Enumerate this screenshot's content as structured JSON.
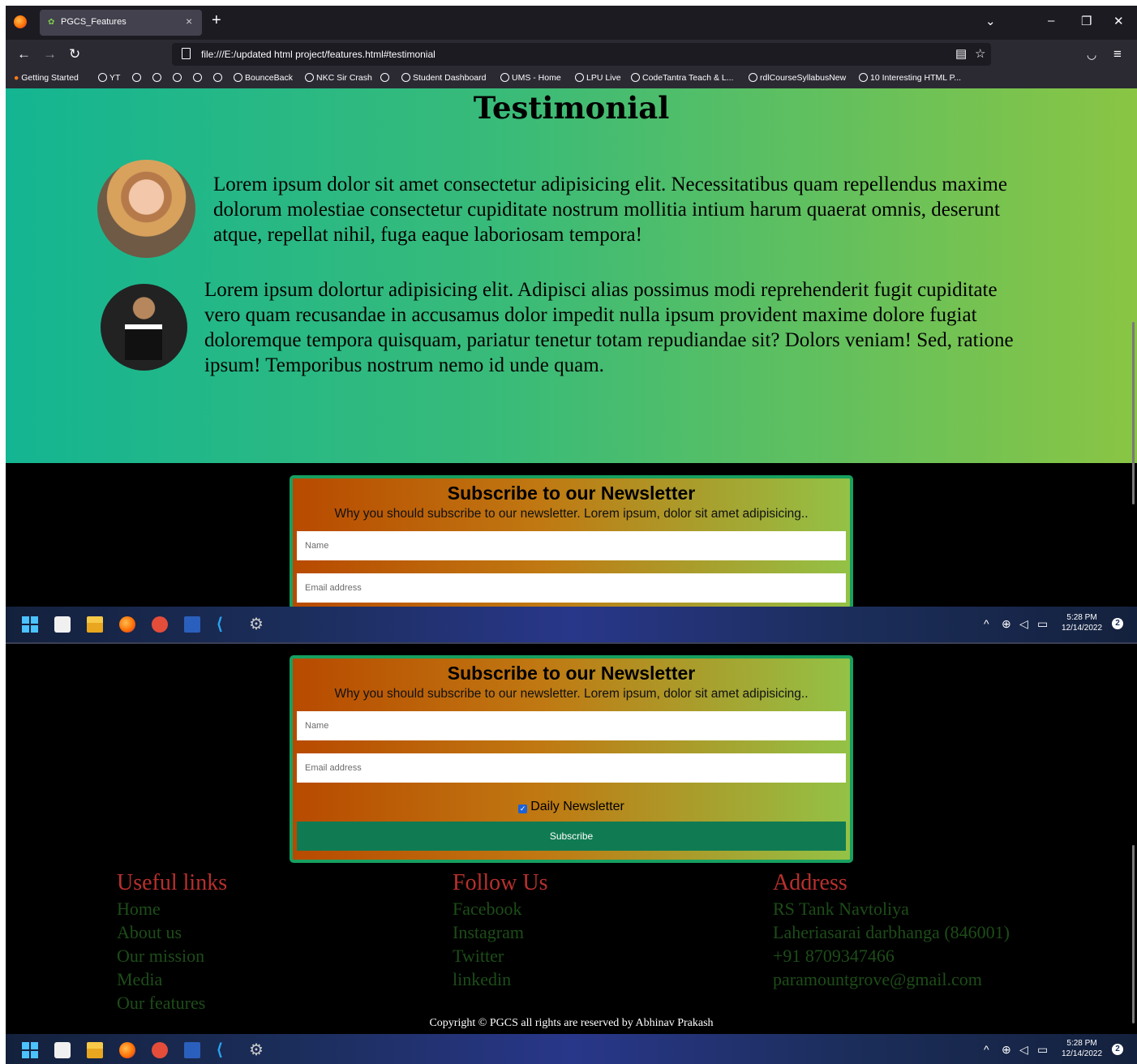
{
  "browser": {
    "tab_title": "PGCS_Features",
    "url": "file:///E:/updated html project/features.html#testimonial",
    "bookmarks": [
      "Getting Started",
      "YT",
      "BounceBack",
      "NKC Sir Crash",
      "Student Dashboard",
      "UMS - Home",
      "LPU Live",
      "CodeTantra Teach & L...",
      "rdlCourseSyllabusNew",
      "10 Interesting HTML P..."
    ]
  },
  "testimonial": {
    "heading": "Testimonial",
    "items": [
      {
        "text": "Lorem ipsum dolor sit amet consectetur adipisicing elit. Necessitatibus quam repellendus maxime dolorum molestiae consectetur cupiditate nostrum mollitia intium harum quaerat omnis, deserunt atque, repellat nihil, fuga eaque laboriosam tempora!"
      },
      {
        "text": "Lorem ipsum dolortur adipisicing elit. Adipisci alias possimus modi reprehenderit fugit cupiditate vero quam recusandae in accusamus dolor impedit nulla ipsum provident maxime dolore fugiat doloremque tempora quisquam, pariatur tenetur totam repudiandae sit? Dolors veniam! Sed, ratione ipsum! Temporibus nostrum nemo id unde quam."
      }
    ]
  },
  "newsletter": {
    "title": "Subscribe to our Newsletter",
    "subtitle": "Why you should subscribe to our newsletter. Lorem ipsum, dolor sit amet adipisicing..",
    "name_placeholder": "Name",
    "email_placeholder": "Email address",
    "checkbox_label": "Daily Newsletter",
    "checkbox_checked": true,
    "button_label": "Subscribe"
  },
  "taskbar": {
    "time": "5:28 PM",
    "date": "12/14/2022",
    "notifications": "2"
  },
  "footer": {
    "useful_links": {
      "heading": "Useful links",
      "items": [
        "Home",
        "About us",
        "Our mission",
        "Media",
        "Our features"
      ]
    },
    "follow_us": {
      "heading": "Follow Us",
      "items": [
        "Facebook",
        "Instagram",
        "Twitter",
        "linkedin"
      ]
    },
    "address": {
      "heading": "Address",
      "items": [
        "RS Tank Navtoliya",
        "Laheriasarai darbhanga (846001)",
        "+91 8709347466",
        "paramountgrove@gmail.com"
      ]
    },
    "copyright": "Copyright © PGCS all rights are reserved by Abhinav Prakash"
  },
  "colors": {
    "testimonial_gradient": [
      "#14b592",
      "#8ac544"
    ],
    "newsletter_border": "#17a060",
    "subscribe_button": "#107b52",
    "footer_heading": "#b8302d",
    "footer_link": "#1d4d18"
  }
}
